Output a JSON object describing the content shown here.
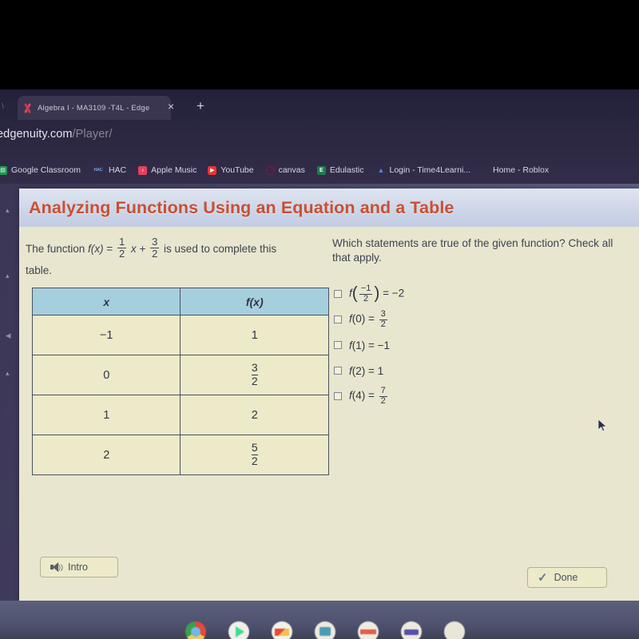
{
  "browser": {
    "tab": {
      "title": "Algebra I - MA3109 -T4L - Edge",
      "favicon": "edgenuity-logo-icon",
      "close_label": "×"
    },
    "new_tab_label": "+",
    "url": {
      "domain": "edgenuity.com",
      "path": "/Player/"
    },
    "bookmarks": [
      {
        "label": "Google Classroom",
        "icon": "google-classroom-icon",
        "icon_text": "▤"
      },
      {
        "label": "HAC",
        "icon": "hac-icon",
        "icon_text": "HAC"
      },
      {
        "label": "Apple Music",
        "icon": "apple-music-icon",
        "icon_text": "♪"
      },
      {
        "label": "YouTube",
        "icon": "youtube-icon",
        "icon_text": "▶"
      },
      {
        "label": "canvas",
        "icon": "canvas-icon",
        "icon_text": ""
      },
      {
        "label": "Edulastic",
        "icon": "edulastic-icon",
        "icon_text": "E"
      },
      {
        "label": "Login - Time4Learni...",
        "icon": "time4learning-icon",
        "icon_text": "▲"
      },
      {
        "label": "Home - Roblox",
        "icon": "roblox-icon",
        "icon_text": ""
      }
    ]
  },
  "lesson": {
    "title": "Analyzing Functions Using an Equation and a Table",
    "prompt": {
      "before": "The function ",
      "fx": "f(x)",
      "equals": " = ",
      "coef_num": "1",
      "coef_den": "2",
      "variable": " x + ",
      "const_num": "3",
      "const_den": "2",
      "after": " is used to complete this",
      "line2": "table."
    },
    "table": {
      "headers": [
        "x",
        "f(x)"
      ],
      "rows": [
        {
          "x": "−1",
          "fx": "1",
          "fx_num": "",
          "fx_den": ""
        },
        {
          "x": "0",
          "fx": "",
          "fx_num": "3",
          "fx_den": "2"
        },
        {
          "x": "1",
          "fx": "2",
          "fx_num": "",
          "fx_den": ""
        },
        {
          "x": "2",
          "fx": "",
          "fx_num": "5",
          "fx_den": "2"
        }
      ]
    },
    "question": "Which statements are true of the given function? Check all that apply.",
    "options": [
      {
        "checked": false,
        "fn": "f",
        "arg": "−1/2",
        "arg_num": "−1",
        "arg_den": "2",
        "paren": true,
        "result": "= −2",
        "res_num": "",
        "res_den": ""
      },
      {
        "checked": false,
        "fn": "f",
        "arg": "(0)",
        "arg_num": "",
        "arg_den": "",
        "paren": false,
        "result": "= ",
        "res_num": "3",
        "res_den": "2"
      },
      {
        "checked": false,
        "fn": "f",
        "arg": "(1)",
        "arg_num": "",
        "arg_den": "",
        "paren": false,
        "result": "= −1",
        "res_num": "",
        "res_den": ""
      },
      {
        "checked": false,
        "fn": "f",
        "arg": "(2)",
        "arg_num": "",
        "arg_den": "",
        "paren": false,
        "result": "= 1",
        "res_num": "",
        "res_den": ""
      },
      {
        "checked": false,
        "fn": "f",
        "arg": "(4)",
        "arg_num": "",
        "arg_den": "",
        "paren": false,
        "result": "= ",
        "res_num": "7",
        "res_den": "2"
      }
    ],
    "buttons": {
      "intro": {
        "label": "Intro",
        "icon": "speaker-icon"
      },
      "done": {
        "label": "Done",
        "icon": "checkmark-icon"
      }
    }
  },
  "colors": {
    "title": "#c94f32",
    "table_header": "#a6cfdd",
    "page_bg": "#e9e6cf",
    "desktop": "#4a4768"
  }
}
